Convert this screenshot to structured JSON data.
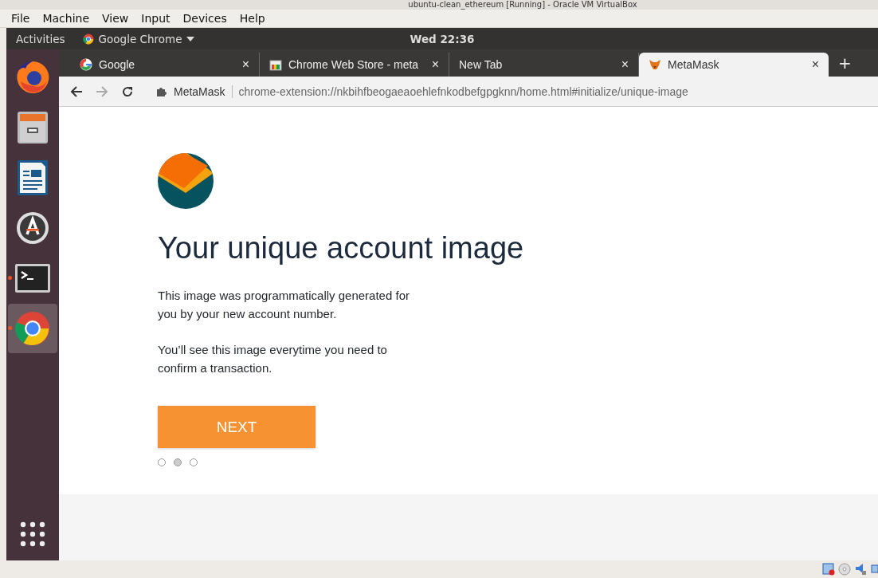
{
  "host_window": {
    "title": "ubuntu-clean_ethereum [Running] - Oracle VM VirtualBox"
  },
  "host_menu": [
    "File",
    "Machine",
    "View",
    "Input",
    "Devices",
    "Help"
  ],
  "top_bar": {
    "activities": "Activities",
    "app_menu": "Google Chrome",
    "clock": "Wed 22:36"
  },
  "dock": [
    {
      "kind": "firefox",
      "running": false,
      "selected": false
    },
    {
      "kind": "files",
      "running": false,
      "selected": false
    },
    {
      "kind": "writer",
      "running": false,
      "selected": false
    },
    {
      "kind": "updater",
      "running": false,
      "selected": false
    },
    {
      "kind": "terminal",
      "running": true,
      "selected": false
    },
    {
      "kind": "chrome",
      "running": true,
      "selected": true
    }
  ],
  "tabs": [
    {
      "kind": "google",
      "title": "Google",
      "close": "×",
      "selected": false
    },
    {
      "kind": "store",
      "title": "Chrome Web Store - meta",
      "close": "×",
      "selected": false
    },
    {
      "kind": "blank",
      "title": "New Tab",
      "close": "×",
      "selected": false
    },
    {
      "kind": "fox",
      "title": "MetaMask",
      "close": "×",
      "selected": true
    }
  ],
  "new_tab": "+",
  "address_bar": {
    "origin": "MetaMask",
    "url": "chrome-extension://nkbihfbeogaeaoehlefnkodbefgpgknn/home.html#initialize/unique-image"
  },
  "page": {
    "heading": "Your unique account image",
    "paragraphs": [
      "This image was programmatically generated for you by your new account number.",
      "You’ll see this image everytime you need to confirm a transaction."
    ],
    "button": "NEXT",
    "steps": [
      {
        "selected": false
      },
      {
        "selected": true
      },
      {
        "selected": false
      }
    ]
  }
}
